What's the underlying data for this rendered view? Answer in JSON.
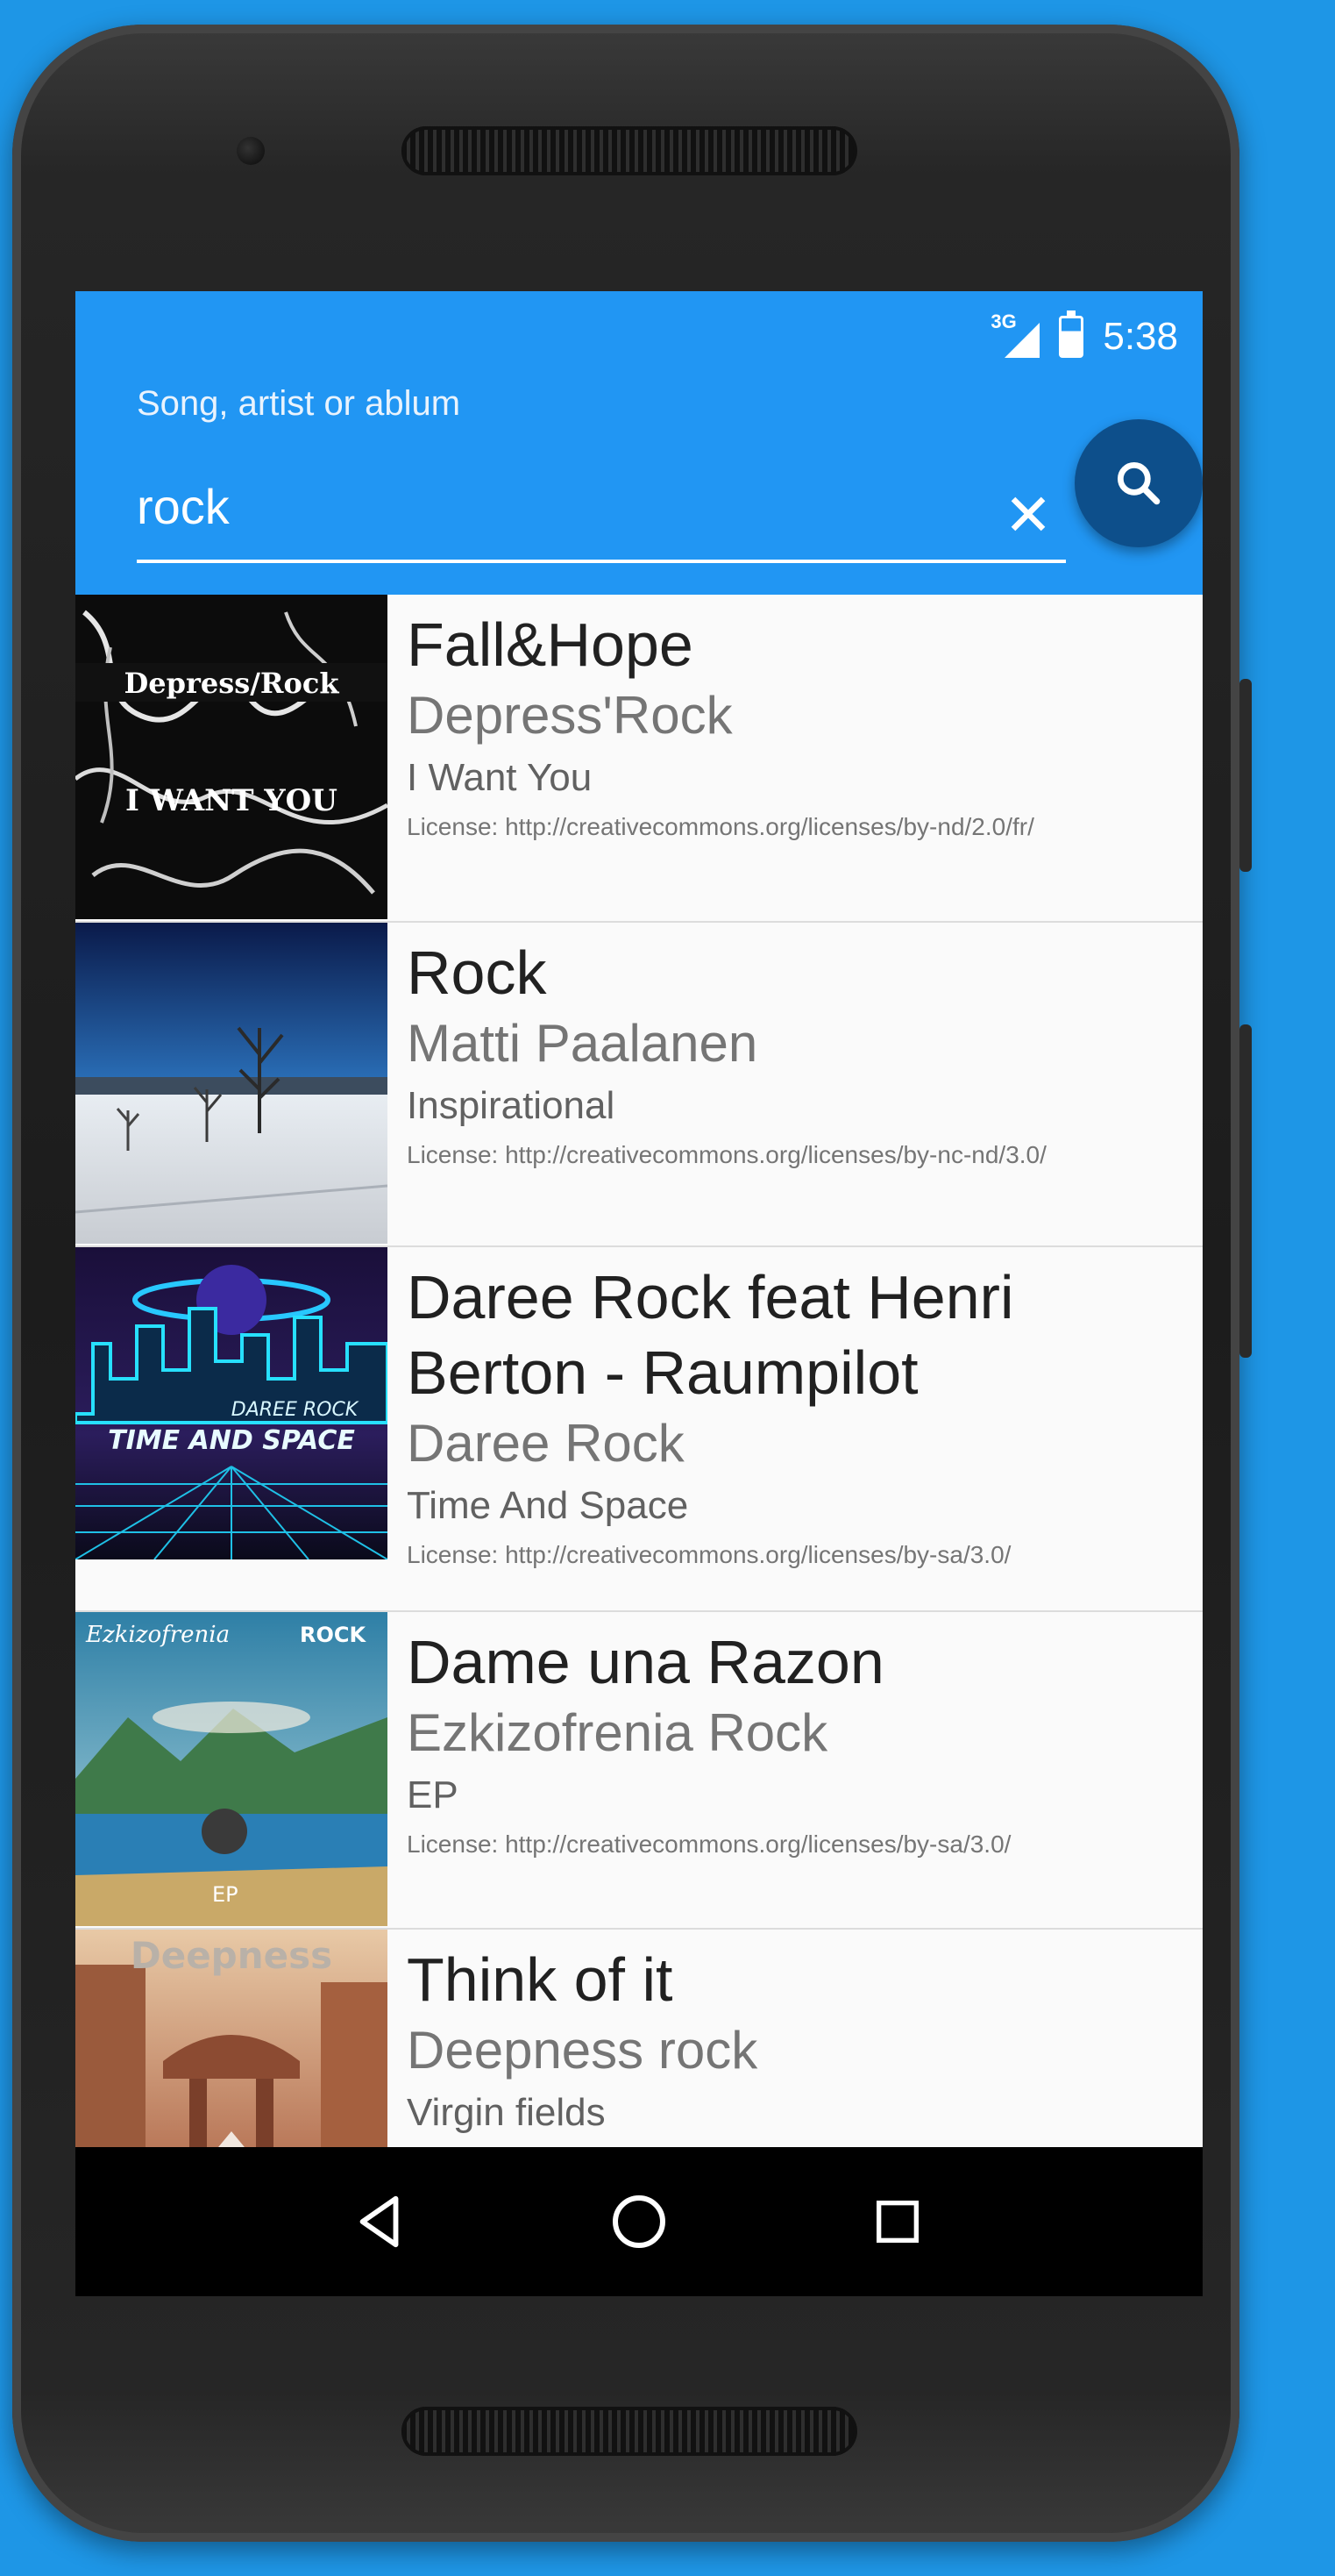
{
  "status_bar": {
    "network_label": "3G",
    "time": "5:38"
  },
  "search": {
    "label": "Song, artist or ablum",
    "value": "rock",
    "clear_icon": "close-icon",
    "submit_icon": "search-icon"
  },
  "results": [
    {
      "title": "Fall&Hope",
      "artist": "Depress'Rock",
      "album": "I Want You",
      "license": "License: http://creativecommons.org/licenses/by-nd/2.0/fr/",
      "cover_text": [
        "Depress/Rock",
        "I WANT YOU"
      ]
    },
    {
      "title": "Rock",
      "artist": "Matti Paalanen",
      "album": "Inspirational",
      "license": "License: http://creativecommons.org/licenses/by-nc-nd/3.0/",
      "cover_text": []
    },
    {
      "title": "Daree Rock feat Henri Berton - Raumpilot",
      "artist": "Daree Rock",
      "album": "Time And Space",
      "license": "License: http://creativecommons.org/licenses/by-sa/3.0/",
      "cover_text": [
        "DAREE ROCK",
        "TIME AND SPACE"
      ]
    },
    {
      "title": "Dame una Razon",
      "artist": "Ezkizofrenia Rock",
      "album": "EP",
      "license": "License: http://creativecommons.org/licenses/by-sa/3.0/",
      "cover_text": [
        "Ezkizofrenia",
        "ROCK",
        "EP"
      ]
    },
    {
      "title": "Think of it",
      "artist": "Deepness rock",
      "album": "Virgin fields",
      "license": "",
      "cover_text": [
        "Deepness"
      ]
    }
  ],
  "nav_bar": {
    "back_icon": "back-triangle-icon",
    "home_icon": "home-circle-icon",
    "recents_icon": "recents-square-icon"
  },
  "colors": {
    "background": "#1e96e6",
    "app_bar": "#2196f3",
    "fab": "#0d4f8b",
    "list_background": "#fafafa"
  }
}
